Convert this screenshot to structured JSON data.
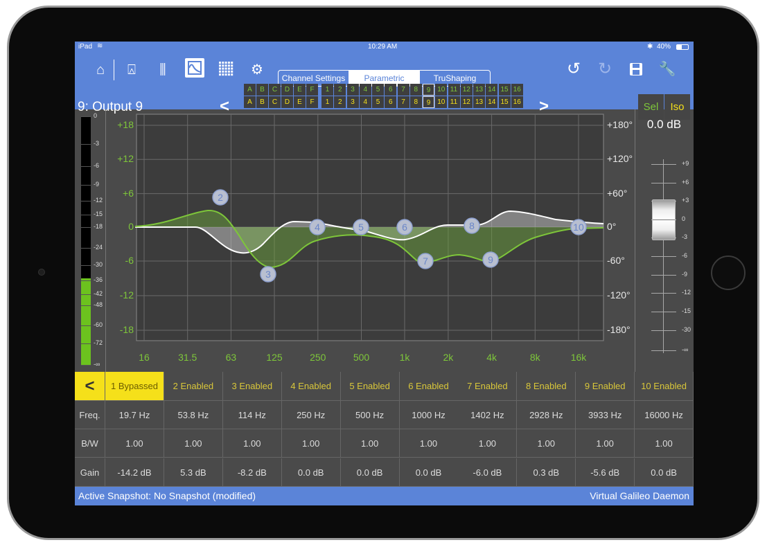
{
  "status": {
    "device": "iPad",
    "time": "10:29 AM",
    "battery": "40%"
  },
  "toolbar": {
    "icons": [
      "home-icon",
      "location-pin-icon",
      "faders-icon",
      "eq-curve-icon",
      "grid-icon",
      "gears-icon"
    ],
    "selected_icon": "eq-curve-icon",
    "tabs": [
      {
        "label": "Channel Settings"
      },
      {
        "label": "Parametric",
        "active": true
      },
      {
        "label": "TruShaping"
      }
    ],
    "right_icons": [
      "undo-icon",
      "redo-icon",
      "save-icon",
      "wrench-icon"
    ]
  },
  "channel": {
    "title": "9: Output 9",
    "prev": "<",
    "next": ">",
    "letters": [
      "A",
      "B",
      "C",
      "D",
      "E",
      "F"
    ],
    "numbers": [
      "1",
      "2",
      "3",
      "4",
      "5",
      "6",
      "7",
      "8",
      "9",
      "10",
      "11",
      "12",
      "13",
      "14",
      "15",
      "16"
    ],
    "selected": "9",
    "sel_label": "Sel",
    "iso_label": "Iso"
  },
  "meter": {
    "ticks": [
      "0",
      "-3",
      "-6",
      "-9",
      "-12",
      "-15",
      "-18",
      "-24",
      "-30",
      "-36",
      "-42",
      "-48",
      "-60",
      "-72",
      "-∞"
    ],
    "level_db": -36
  },
  "graph": {
    "gain_ticks": [
      "+18",
      "+12",
      "+6",
      "0",
      "-6",
      "-12",
      "-18"
    ],
    "phase_ticks": [
      "+180°",
      "+120°",
      "+60°",
      "0°",
      "-60°",
      "-120°",
      "-180°"
    ],
    "freq_ticks": [
      "16",
      "31.5",
      "63",
      "125",
      "250",
      "500",
      "1k",
      "2k",
      "4k",
      "8k",
      "16k"
    ],
    "nodes": [
      "2",
      "3",
      "4",
      "5",
      "6",
      "7",
      "8",
      "9",
      "10"
    ],
    "colors": {
      "magnitude": "#7ec63a",
      "phase": "#ffffff",
      "node": "#b8bfd0"
    }
  },
  "fader": {
    "value": "0.0 dB",
    "ticks": [
      "+9",
      "+6",
      "+3",
      "0",
      "-3",
      "-6",
      "-9",
      "-12",
      "-15",
      "-30",
      "-∞"
    ],
    "level_db": 0
  },
  "bands": {
    "back": "<",
    "row_labels": [
      "Freq.",
      "B/W",
      "Gain"
    ],
    "items": [
      {
        "status": "1 Bypassed",
        "freq": "19.7 Hz",
        "bw": "1.00",
        "gain": "-14.2 dB"
      },
      {
        "status": "2 Enabled",
        "freq": "53.8 Hz",
        "bw": "1.00",
        "gain": "5.3 dB"
      },
      {
        "status": "3 Enabled",
        "freq": "114 Hz",
        "bw": "1.00",
        "gain": "-8.2 dB"
      },
      {
        "status": "4 Enabled",
        "freq": "250 Hz",
        "bw": "1.00",
        "gain": "0.0 dB"
      },
      {
        "status": "5 Enabled",
        "freq": "500 Hz",
        "bw": "1.00",
        "gain": "0.0 dB"
      },
      {
        "status": "6 Enabled",
        "freq": "1000 Hz",
        "bw": "1.00",
        "gain": "0.0 dB"
      },
      {
        "status": "7 Enabled",
        "freq": "1402 Hz",
        "bw": "1.00",
        "gain": "-6.0 dB"
      },
      {
        "status": "8 Enabled",
        "freq": "2928 Hz",
        "bw": "1.00",
        "gain": "0.3 dB"
      },
      {
        "status": "9 Enabled",
        "freq": "3933 Hz",
        "bw": "1.00",
        "gain": "-5.6 dB"
      },
      {
        "status": "10 Enabled",
        "freq": "16000 Hz",
        "bw": "1.00",
        "gain": "0.0 dB"
      }
    ]
  },
  "footer": {
    "snapshot": "Active Snapshot: No Snapshot (modified)",
    "server": "Virtual Galileo Daemon"
  },
  "colors": {
    "accent": "#5b84d8",
    "yellow": "#f5e01a",
    "green": "#7ec63a"
  }
}
